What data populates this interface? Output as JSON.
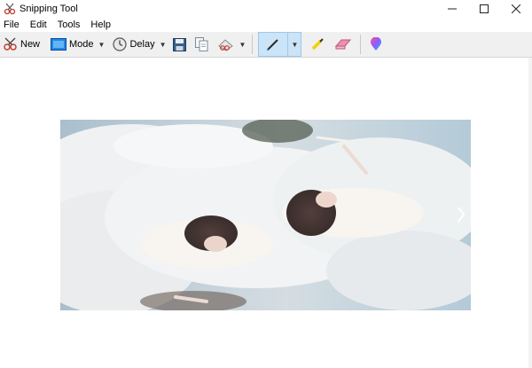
{
  "window": {
    "title": "Snipping Tool",
    "controls": [
      "minimize",
      "maximize",
      "close"
    ]
  },
  "menu": {
    "items": [
      "File",
      "Edit",
      "Tools",
      "Help"
    ]
  },
  "toolbar": {
    "new_label": "New",
    "mode_label": "Mode",
    "delay_label": "Delay",
    "icons": [
      "new-snip-icon",
      "mode-icon",
      "delay-clock-icon",
      "save-icon",
      "copy-icon",
      "send-snip-icon",
      "pen-icon",
      "highlighter-icon",
      "eraser-icon",
      "paint-3d-icon"
    ]
  },
  "colors": {
    "toolbar_bg": "#f0f0f0",
    "pen_selected_bg": "#cce4f7",
    "highlighter": "#f5d000",
    "eraser": "#f08fb0"
  }
}
